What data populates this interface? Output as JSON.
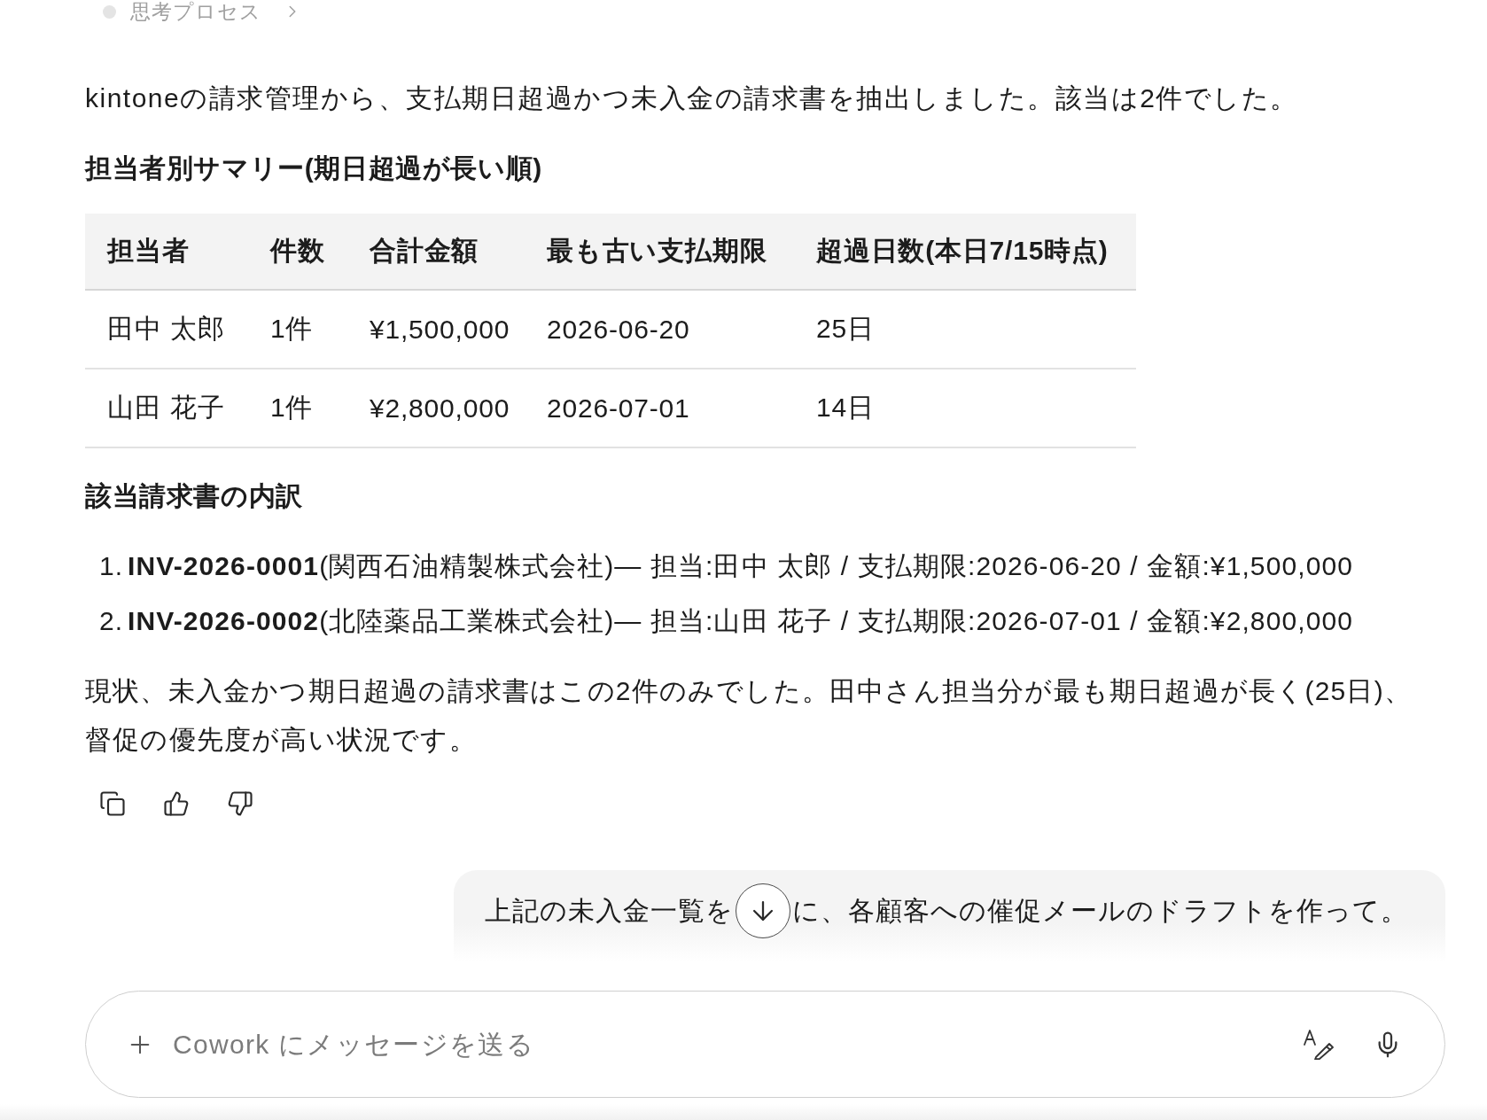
{
  "thinking_toggle": {
    "label": "思考プロセス",
    "expanded": false
  },
  "response": {
    "intro": "kintoneの請求管理から、支払期日超過かつ未入金の請求書を抽出しました。該当は2件でした。",
    "summary_heading": "担当者別サマリー(期日超過が長い順)",
    "summary_table": {
      "columns": [
        "担当者",
        "件数",
        "合計金額",
        "最も古い支払期限",
        "超過日数(本日7/15時点)"
      ],
      "rows": [
        [
          "田中 太郎",
          "1件",
          "¥1,500,000",
          "2026-06-20",
          "25日"
        ],
        [
          "山田 花子",
          "1件",
          "¥2,800,000",
          "2026-07-01",
          "14日"
        ]
      ]
    },
    "breakdown_heading": "該当請求書の内訳",
    "breakdown_items": [
      {
        "number": "1.",
        "text": "**INV-2026-0001**(関西石油精製株式会社)— 担当:田中 太郎 / 支払期限:2026-06-20 / 金額:¥1,500,000"
      },
      {
        "number": "2.",
        "text": "**INV-2026-0002**(北陸薬品工業株式会社)— 担当:山田 花子 / 支払期限:2026-07-01 / 金額:¥2,800,000"
      }
    ],
    "conclusion": "現状、未入金かつ期日超過の請求書はこの2件のみでした。田中さん担当分が最も期日超過が長く(25日)、督促の優先度が高い状況です。"
  },
  "user_message": {
    "text_before": "上記の未入金一覧を",
    "text_after": "に、各顧客への催促メールのドラフトを作って。"
  },
  "composer": {
    "placeholder": "Cowork にメッセージを送る"
  }
}
